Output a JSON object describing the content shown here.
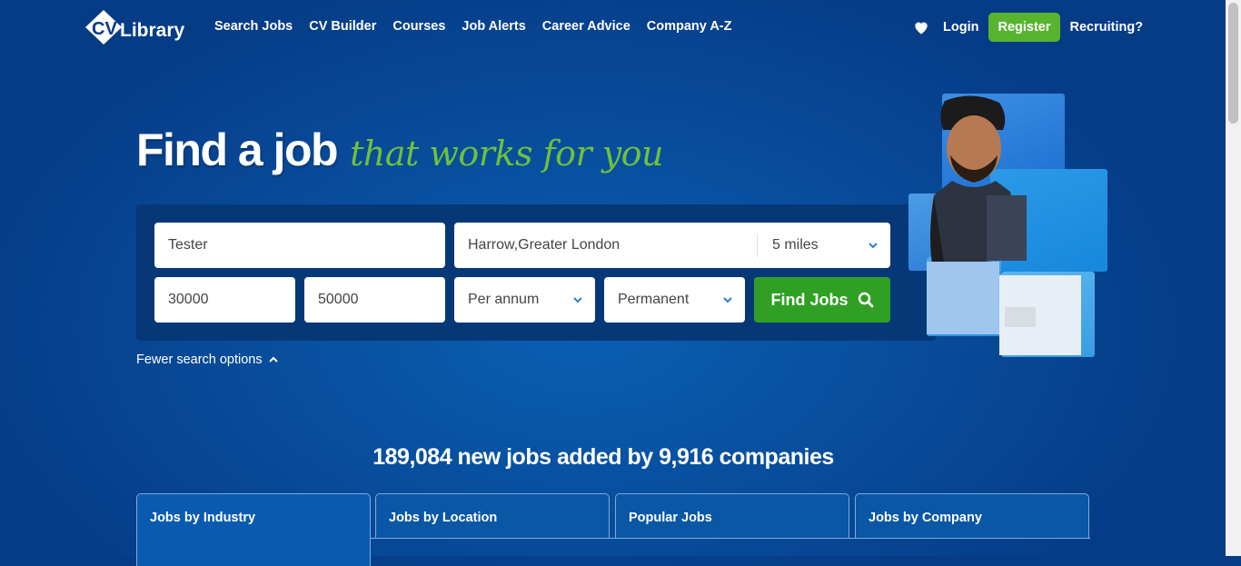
{
  "header": {
    "logo_text": "CV Library",
    "nav": [
      "Search Jobs",
      "CV Builder",
      "Courses",
      "Job Alerts",
      "Career Advice",
      "Company A-Z"
    ],
    "login": "Login",
    "register": "Register",
    "recruiting": "Recruiting?",
    "heart_icon": "heart-icon"
  },
  "hero": {
    "headline_main": "Find a job",
    "headline_script": "that works for you"
  },
  "search": {
    "keywords": "Tester",
    "location": "Harrow,Greater London",
    "distance": "5 miles",
    "salary_min": "30000",
    "salary_max": "50000",
    "salary_period": "Per annum",
    "job_type": "Permanent",
    "find_button": "Find Jobs",
    "fewer_options": "Fewer search options"
  },
  "stats": {
    "headline": "189,084 new jobs added by 9,916 companies"
  },
  "tabs": [
    "Jobs by Industry",
    "Jobs by Location",
    "Popular Jobs",
    "Jobs by Company"
  ],
  "colors": {
    "bg": "#063b86",
    "green": "#58b42f",
    "find_green": "#2fa024",
    "script_green": "#6fc13b"
  }
}
